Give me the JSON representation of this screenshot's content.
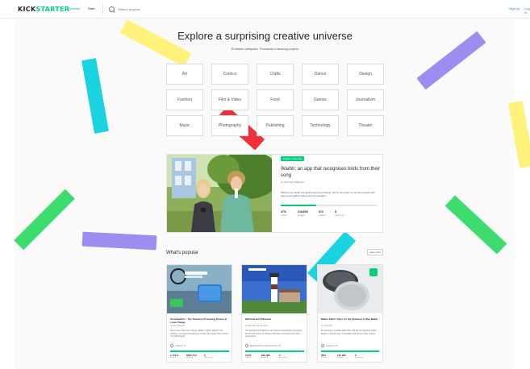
{
  "header": {
    "logo_prefix": "KICK",
    "logo_suffix": "STARTER",
    "nav_discover": "Discover",
    "nav_start": "Start",
    "search_placeholder": "Search projects",
    "sign_in": "Sign up",
    "log_in": "Log in"
  },
  "hero": {
    "title": "Explore a surprising creative universe",
    "subtitle": "15 diverse categories. Thousands of amazing projects."
  },
  "categories": [
    "Art",
    "Comics",
    "Crafts",
    "Dance",
    "Design",
    "Fashion",
    "Film & Video",
    "Food",
    "Games",
    "Journalism",
    "Music",
    "Photography",
    "Publishing",
    "Technology",
    "Theater"
  ],
  "featured": {
    "badge": "Project of the day",
    "title": "Warblr: an app that recognises birds from their song",
    "author": "by Florence Wilkinson",
    "description": "Warblr is an audio recognition app for birdsong. We're using tech to connect people with nature and gather data to aid conservation.",
    "funded_fraction": 0.37,
    "stats": [
      {
        "value": "37%",
        "label": "funded"
      },
      {
        "value": "£18,603",
        "label": "pledged"
      },
      {
        "value": "572",
        "label": "backers"
      },
      {
        "value": "8",
        "label": "days to go"
      }
    ]
  },
  "popular": {
    "title": "What's popular",
    "view_more": "View more",
    "cards": [
      {
        "title": "SnowFeather - The Smartest Protecting Device at Lower Range",
        "author": "by Zoe Peterson",
        "description": "Never Lose Your Keys, Phone, Wallet, Laptop, Bag Or Your Children, or Forget Something at a Cafe! No Longer Worry About Your Belongings",
        "location": "Orlando, FL",
        "funded_fraction": 1.0,
        "stats": [
          {
            "value": "1,701%",
            "label": "funded"
          },
          {
            "value": "$680,719",
            "label": "pledged"
          },
          {
            "value": "5",
            "label": "days to go"
          }
        ]
      },
      {
        "title": "Montauk Surf Museum",
        "author": "by Montauk Surf Museum",
        "description": "The Montauk Surf Museum will preserve local history as well as the art and history of surfing in Montauk and beyond for future generations.",
        "location": "Montauk Point, Lake Ronkonk, NY",
        "funded_fraction": 1.0,
        "stats": [
          {
            "value": "104%",
            "label": "funded"
          },
          {
            "value": "$26,085",
            "label": "pledged"
          },
          {
            "value": "2",
            "label": "days to go"
          }
        ]
      },
      {
        "title": "Walter Fabric Filter for the Spinning Coffee Maker",
        "author": "by Cold Lab",
        "description": "An accessory reusable fabric filter that fits our Spinning Coffee Maker in a gentle way. Compatible with all our coffee makers.",
        "location": "Liverpool, UK",
        "funded_fraction": 0.98,
        "stats": [
          {
            "value": "98%",
            "label": "funded"
          },
          {
            "value": "£15,995",
            "label": "pledged"
          },
          {
            "value": "6",
            "label": "days to go"
          }
        ]
      }
    ]
  },
  "colors": {
    "brand_green": "#05ce78",
    "confetti_yellow": "#fff27a",
    "confetti_cyan": "#1ad3e0",
    "confetti_purple": "#9f8cf0",
    "confetti_green": "#3ddc6e",
    "confetti_red": "#f0303a"
  }
}
